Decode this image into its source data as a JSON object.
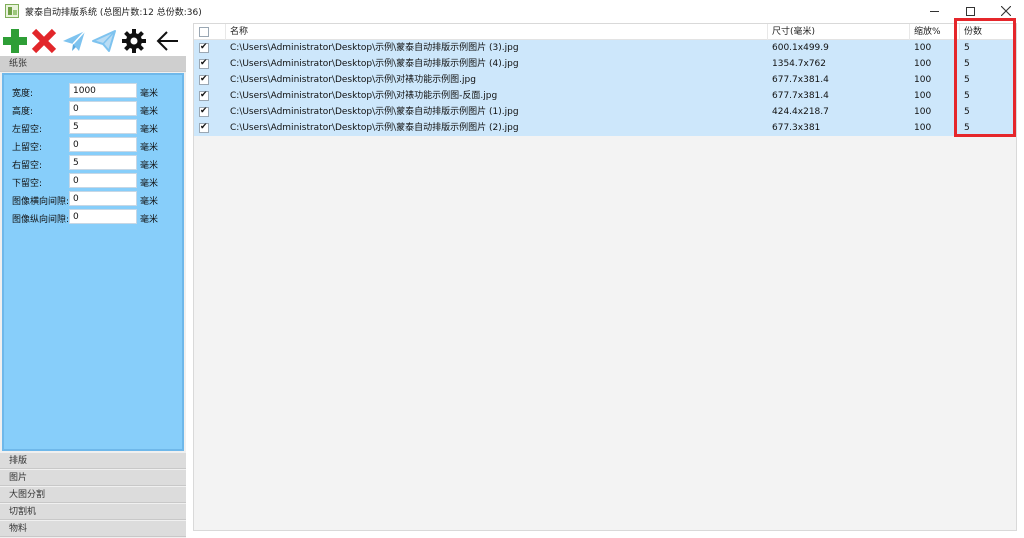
{
  "window": {
    "title": "蒙泰自动排版系统 (总图片数:12 总份数:36)"
  },
  "toolbar": {
    "add_icon": "plus-icon",
    "delete_icon": "x-icon",
    "send_icon": "paper-plane-icon",
    "send_outline_icon": "paper-plane-outline-icon",
    "settings_icon": "gear-icon",
    "back_icon": "arrow-left-icon"
  },
  "sections": {
    "paper": "纸张",
    "layout": "排版",
    "images": "图片",
    "split": "大图分割",
    "cutter": "切割机",
    "material": "物料"
  },
  "paper_fields": [
    {
      "label": "宽度:",
      "value": "1000",
      "unit": "毫米"
    },
    {
      "label": "高度:",
      "value": "0",
      "unit": "毫米"
    },
    {
      "label": "左留空:",
      "value": "5",
      "unit": "毫米"
    },
    {
      "label": "上留空:",
      "value": "0",
      "unit": "毫米"
    },
    {
      "label": "右留空:",
      "value": "5",
      "unit": "毫米"
    },
    {
      "label": "下留空:",
      "value": "0",
      "unit": "毫米"
    },
    {
      "label": "图像横向间隙:",
      "value": "0",
      "unit": "毫米"
    },
    {
      "label": "图像纵向间隙:",
      "value": "0",
      "unit": "毫米"
    }
  ],
  "table": {
    "headers": {
      "name": "名称",
      "size": "尺寸(毫米)",
      "scale": "缩放%",
      "copies": "份数"
    },
    "rows": [
      {
        "checked": "✔",
        "name": "C:\\Users\\Administrator\\Desktop\\示例\\蒙泰自动排版示例图片 (3).jpg",
        "size": "600.1x499.9",
        "scale": "100",
        "copies": "5"
      },
      {
        "checked": "✔",
        "name": "C:\\Users\\Administrator\\Desktop\\示例\\蒙泰自动排版示例图片 (4).jpg",
        "size": "1354.7x762",
        "scale": "100",
        "copies": "5"
      },
      {
        "checked": "✔",
        "name": "C:\\Users\\Administrator\\Desktop\\示例\\对裱功能示例图.jpg",
        "size": "677.7x381.4",
        "scale": "100",
        "copies": "5"
      },
      {
        "checked": "✔",
        "name": "C:\\Users\\Administrator\\Desktop\\示例\\对裱功能示例图-反面.jpg",
        "size": "677.7x381.4",
        "scale": "100",
        "copies": "5"
      },
      {
        "checked": "✔",
        "name": "C:\\Users\\Administrator\\Desktop\\示例\\蒙泰自动排版示例图片 (1).jpg",
        "size": "424.4x218.7",
        "scale": "100",
        "copies": "5"
      },
      {
        "checked": "✔",
        "name": "C:\\Users\\Administrator\\Desktop\\示例\\蒙泰自动排版示例图片 (2).jpg",
        "size": "677.3x381",
        "scale": "100",
        "copies": "5"
      }
    ]
  },
  "colors": {
    "paper_panel": "#87cefa",
    "row_selected": "#cde7fb",
    "highlight_box": "#e5262b",
    "add_green": "#2e9e36",
    "delete_red": "#e2262a",
    "send_blue": "#7ec3ef"
  }
}
